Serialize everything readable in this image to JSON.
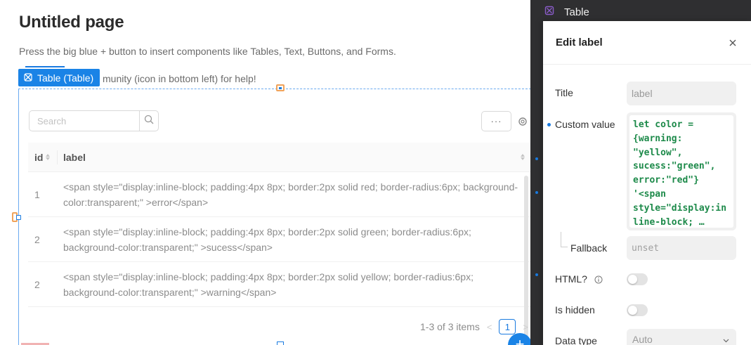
{
  "page": {
    "title": "Untitled page",
    "hint": "Press the big blue + button to insert components like Tables, Text, Buttons, and Forms.",
    "community_hint": "munity (icon in bottom left) for help!"
  },
  "component_tag": {
    "label": "Table (Table)"
  },
  "table": {
    "search_placeholder": "Search",
    "more_label": "···",
    "columns": [
      "id",
      "label"
    ],
    "rows": [
      {
        "id": "1",
        "label": "<span style=\"display:inline-block; padding:4px 8px; border:2px solid red; border-radius:6px; background-color:transparent;\" >error</span>"
      },
      {
        "id": "2",
        "label": "<span style=\"display:inline-block; padding:4px 8px; border:2px solid green; border-radius:6px; background-color:transparent;\" >sucess</span>"
      },
      {
        "id": "2",
        "label": "<span style=\"display:inline-block; padding:4px 8px; border:2px solid yellow; border-radius:6px; background-color:transparent;\" >warning</span>"
      }
    ],
    "pagination": {
      "summary": "1-3 of 3 items",
      "current_page": "1",
      "prev": "<",
      "next": ">"
    },
    "fab_label": "+"
  },
  "inspector": {
    "header_title": "Table"
  },
  "editor": {
    "title": "Edit label",
    "fields": {
      "title_label": "Title",
      "title_value": "label",
      "custom_value_label": "Custom value",
      "custom_value_code": "let color =\n{warning:\n\"yellow\",\nsucess:\"green\",\nerror:\"red\"}\n'<span\nstyle=\"display:in\nline-block; …",
      "fallback_label": "Fallback",
      "fallback_value": "unset",
      "html_label": "HTML?",
      "hidden_label": "Is hidden",
      "data_type_label": "Data type",
      "data_type_value": "Auto"
    }
  },
  "colors": {
    "accent": "#1a83e6",
    "code_green": "#1d8a4a",
    "inspector_bg": "#2f2f31"
  }
}
